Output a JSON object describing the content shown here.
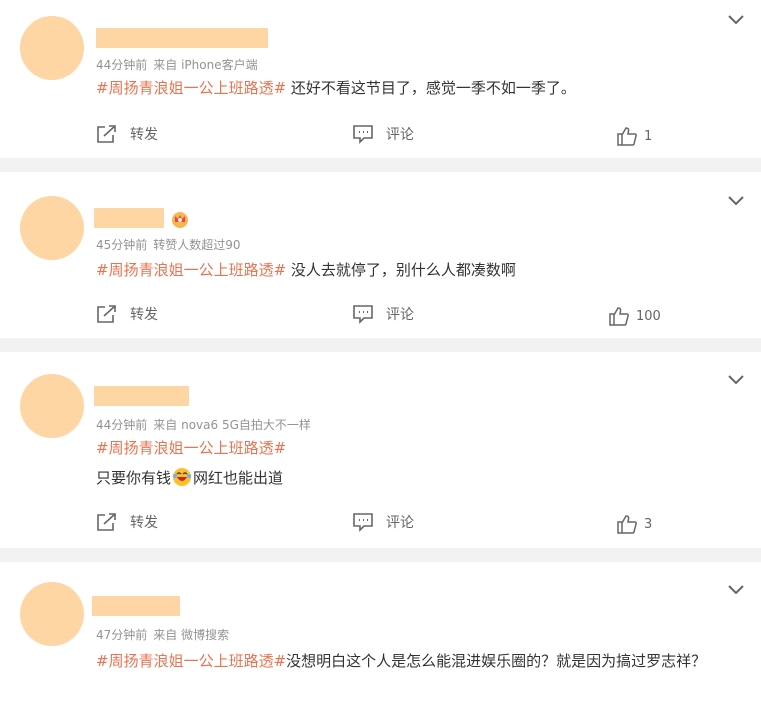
{
  "posts": [
    {
      "time": "44分钟前",
      "source": "来自 iPhone客户端",
      "topic": "#周扬青浪姐一公上班路透#",
      "text": " 还好不看这节目了，感觉一季不如一季了。",
      "repost_label": "转发",
      "comment_label": "评论",
      "like_count": "1"
    },
    {
      "time": "45分钟前",
      "source": "转赞人数超过90",
      "topic": "#周扬青浪姐一公上班路透#",
      "text": " 没人去就停了，别什么人都凑数啊",
      "repost_label": "转发",
      "comment_label": "评论",
      "like_count": "100",
      "badge_icon": "crown-icon"
    },
    {
      "time": "44分钟前",
      "source": "来自 nova6 5G自拍大不一样",
      "topic": "#周扬青浪姐一公上班路透#",
      "text_a": "只要你有钱",
      "emoji_icon": "laughing-crying-emoji",
      "text_b": "网红也能出道",
      "repost_label": "转发",
      "comment_label": "评论",
      "like_count": "3"
    },
    {
      "time": "47分钟前",
      "source": "来自 微博搜索",
      "topic": "#周扬青浪姐一公上班路透#",
      "text": "没想明白这个人是怎么能混进娱乐圈的？就是因为搞过罗志祥？"
    }
  ],
  "colors": {
    "topic": "#eb7350",
    "avatar": "#fdd6a3",
    "meta": "#939393",
    "background": "#f2f2f2"
  }
}
